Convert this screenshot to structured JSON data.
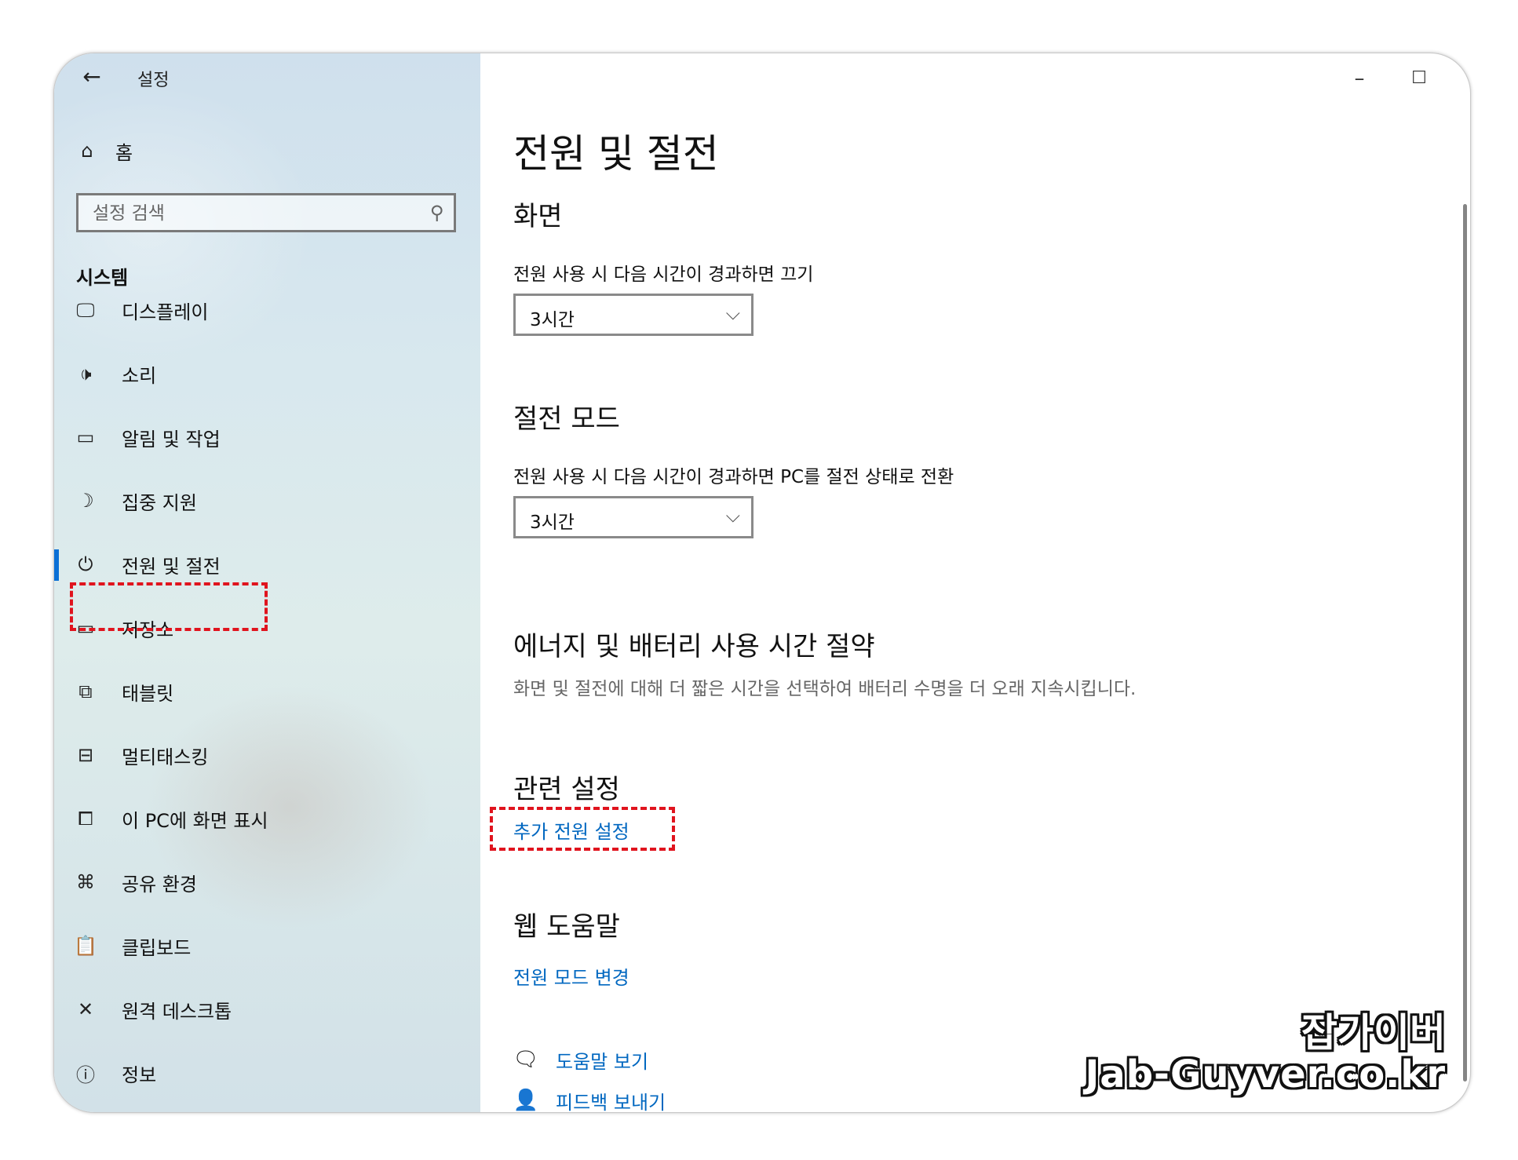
{
  "window": {
    "title": "설정"
  },
  "sidebar": {
    "home_label": "홈",
    "search_placeholder": "설정 검색",
    "section_heading": "시스템",
    "items": [
      {
        "icon": "display-icon",
        "label": "디스플레이"
      },
      {
        "icon": "speaker-icon",
        "label": "소리"
      },
      {
        "icon": "notification-icon",
        "label": "알림 및 작업"
      },
      {
        "icon": "moon-icon",
        "label": "집중 지원"
      },
      {
        "icon": "power-icon",
        "label": "전원 및 절전",
        "selected": true
      },
      {
        "icon": "storage-icon",
        "label": "저장소"
      },
      {
        "icon": "tablet-icon",
        "label": "태블릿"
      },
      {
        "icon": "multitasking-icon",
        "label": "멀티태스킹"
      },
      {
        "icon": "project-icon",
        "label": "이 PC에 화면 표시"
      },
      {
        "icon": "share-icon",
        "label": "공유 환경"
      },
      {
        "icon": "clipboard-icon",
        "label": "클립보드"
      },
      {
        "icon": "remote-desktop-icon",
        "label": "원격 데스크톱"
      },
      {
        "icon": "info-icon",
        "label": "정보"
      }
    ]
  },
  "main": {
    "title": "전원 및 절전",
    "screen": {
      "heading": "화면",
      "description": "전원 사용 시 다음 시간이 경과하면 끄기",
      "value": "3시간"
    },
    "sleep": {
      "heading": "절전 모드",
      "description": "전원 사용 시 다음 시간이 경과하면 PC를 절전 상태로 전환",
      "value": "3시간"
    },
    "energy": {
      "heading": "에너지 및 배터리 사용 시간 절약",
      "description": "화면 및 절전에 대해 더 짧은 시간을 선택하여 배터리 수명을 더 오래 지속시킵니다."
    },
    "related": {
      "heading": "관련 설정",
      "link": "추가 전원 설정"
    },
    "web_help": {
      "heading": "웹 도움말",
      "link": "전원 모드 변경"
    },
    "help_links": [
      {
        "icon": "help-chat-icon",
        "label": "도움말 보기"
      },
      {
        "icon": "feedback-icon",
        "label": "피드백 보내기"
      }
    ]
  },
  "watermark": {
    "korean": "잡가이버",
    "site": "Jab-Guyver.co.kr"
  },
  "colors": {
    "accent": "#0067c0",
    "highlight": "#e0141e",
    "selection_bar": "#0a6fd6"
  }
}
